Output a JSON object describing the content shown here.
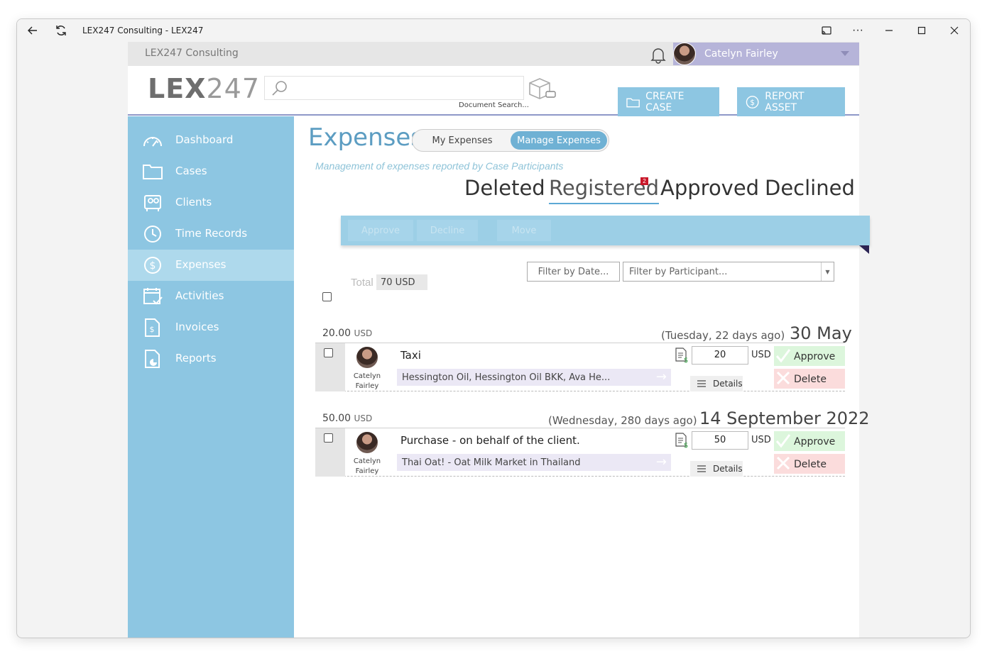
{
  "window": {
    "title": "LEX247 Consulting - LEX247"
  },
  "topbar": {
    "company": "LEX247 Consulting",
    "user_name": "Catelyn Fairley"
  },
  "header": {
    "logo_lex": "LEX",
    "logo_num": "247",
    "search_placeholder": "",
    "search_caption": "Document Search...",
    "create_case": "CREATE CASE",
    "report_asset": "REPORT ASSET"
  },
  "sidebar": {
    "items": [
      {
        "label": "Dashboard",
        "icon": "gauge-icon"
      },
      {
        "label": "Cases",
        "icon": "folder-icon"
      },
      {
        "label": "Clients",
        "icon": "contacts-icon"
      },
      {
        "label": "Time Records",
        "icon": "clock-icon"
      },
      {
        "label": "Expenses",
        "icon": "dollar-circle-icon",
        "active": true
      },
      {
        "label": "Activities",
        "icon": "calendar-check-icon"
      },
      {
        "label": "Invoices",
        "icon": "invoice-icon"
      },
      {
        "label": "Reports",
        "icon": "report-icon"
      }
    ]
  },
  "main": {
    "title": "Expenses",
    "segment": {
      "option1": "My Expenses",
      "option2": "Manage Expenses",
      "selected": "Manage Expenses"
    },
    "subtitle": "Management of expenses reported by Case Participants",
    "tabs": [
      {
        "label": "Deleted"
      },
      {
        "label": "Registered",
        "active": true,
        "badge": "2"
      },
      {
        "label": "Approved"
      },
      {
        "label": "Declined"
      }
    ],
    "actions": {
      "approve": "Approve",
      "decline": "Decline",
      "move": "Move"
    },
    "filters": {
      "date_placeholder": "Filter by Date...",
      "participant_placeholder": "Filter by Participant..."
    },
    "total": {
      "label": "Total",
      "value": "70 USD"
    }
  },
  "groups": [
    {
      "amount": "20.00",
      "currency": "USD",
      "day": "(Tuesday, 22 days ago)",
      "date": "30 May",
      "rows": [
        {
          "participant_first": "Catelyn",
          "participant_last": "Fairley",
          "description": "Taxi",
          "cases": "Hessington Oil, Hessington Oil BKK, Ava He...",
          "quantity": "20",
          "currency": "USD",
          "details": "Details",
          "approve": "Approve",
          "delete": "Delete"
        }
      ]
    },
    {
      "amount": "50.00",
      "currency": "USD",
      "day": "(Wednesday, 280 days ago)",
      "date": "14 September 2022",
      "rows": [
        {
          "participant_first": "Catelyn",
          "participant_last": "Fairley",
          "description": "Purchase - on behalf of the client.",
          "cases": "Thai Oat! - Oat Milk Market in Thailand",
          "quantity": "50",
          "currency": "USD",
          "details": "Details",
          "approve": "Approve",
          "delete": "Delete"
        }
      ]
    }
  ]
}
